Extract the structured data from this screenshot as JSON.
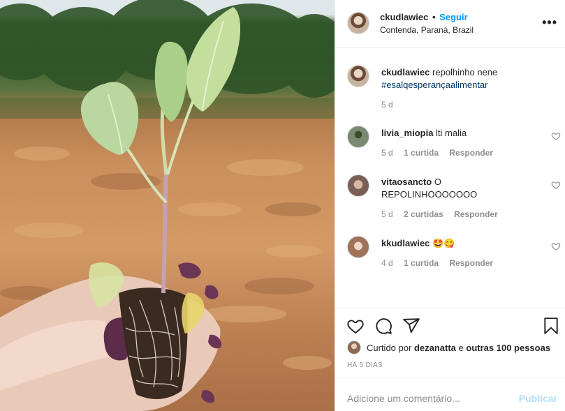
{
  "post": {
    "username": "ckudlawiec",
    "separator": "•",
    "follow_label": "Seguir",
    "location": "Contenda, Paraná, Brazil",
    "more_label": "•••"
  },
  "caption": {
    "username": "ckudlawiec",
    "text": "repolhinho nene",
    "hashtag": "#esalqesperançaalimentar",
    "time": "5 d"
  },
  "comments": [
    {
      "username": "livia_miopia",
      "text": "lti malia",
      "time": "5 d",
      "likes": "1 curtida",
      "reply": "Responder"
    },
    {
      "username": "vitaosancto",
      "text": "O REPOLINHOOOOOOO",
      "time": "5 d",
      "likes": "2 curtidas",
      "reply": "Responder"
    },
    {
      "username": "kkudlawiec",
      "text": "🤩😋",
      "time": "4 d",
      "likes": "1 curtida",
      "reply": "Responder"
    }
  ],
  "likes": {
    "prefix": "Curtido por",
    "user": "dezanatta",
    "connector": "e",
    "others": "outras 100 pessoas"
  },
  "posted_ago": "HÁ 5 DIAS",
  "add_comment": {
    "placeholder": "Adicione um comentário...",
    "publish_label": "Publicar"
  },
  "colors": {
    "link": "#0095f6",
    "hashtag": "#00376b",
    "muted": "#8e8e8e",
    "publish_disabled": "#b2dffc"
  },
  "icons": [
    "heart-icon",
    "comment-icon",
    "share-icon",
    "bookmark-icon",
    "more-icon"
  ]
}
